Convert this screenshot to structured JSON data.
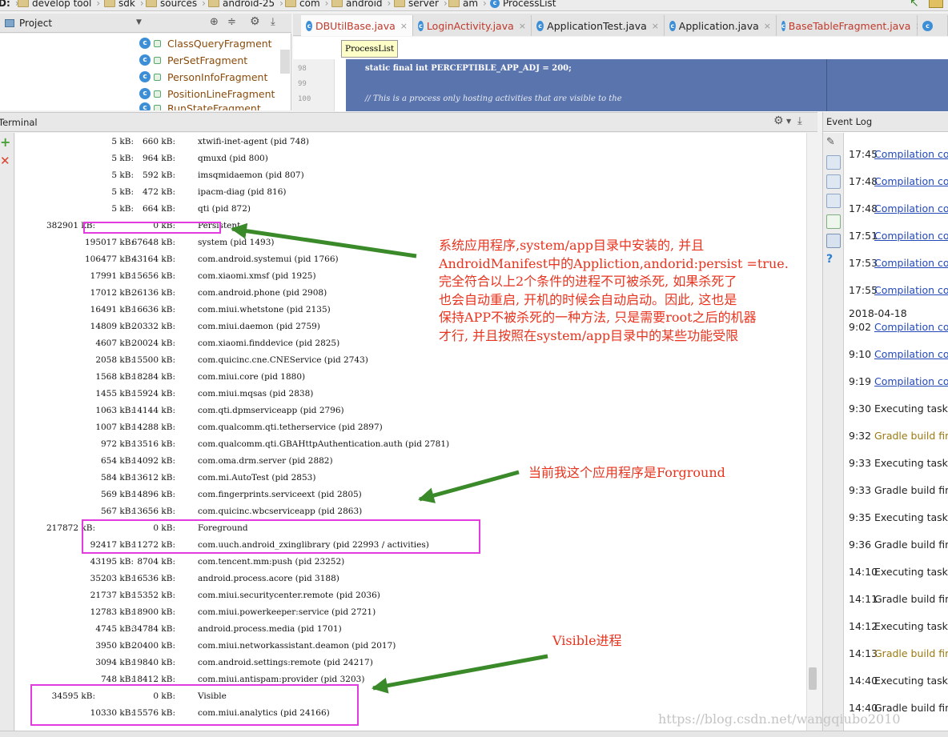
{
  "breadcrumb": {
    "drive": "D:",
    "items": [
      "develop tool",
      "sdk",
      "sources",
      "android-25",
      "com",
      "android",
      "server",
      "am"
    ],
    "current": "ProcessList"
  },
  "project_panel": {
    "title": "Project",
    "tree": [
      "ClassQueryFragment",
      "PerSetFragment",
      "PersonInfoFragment",
      "PositionLineFragment",
      "RunStateFragment"
    ]
  },
  "editor": {
    "tabs": [
      "DBUtilBase.java",
      "LoginActivity.java",
      "ApplicationTest.java",
      "Application.java",
      "BaseTableFragment.java"
    ],
    "tooltip": "ProcessList",
    "lines": [
      {
        "num": "98",
        "code": "static final int PERCEPTIBLE_APP_ADJ = 200;"
      },
      {
        "num": "99",
        "code": ""
      },
      {
        "num": "100",
        "code": "// This is a process only hosting activities that are visible to the"
      }
    ]
  },
  "terminal": {
    "title": "Terminal",
    "rows": [
      {
        "total": "",
        "pss": "5 kB:",
        "mem": "660 kB:",
        "name": "xtwifi-inet-agent (pid 748)"
      },
      {
        "total": "",
        "pss": "5 kB:",
        "mem": "964 kB:",
        "name": "qmuxd (pid 800)"
      },
      {
        "total": "",
        "pss": "5 kB:",
        "mem": "592 kB:",
        "name": "imsqmidaemon (pid 807)"
      },
      {
        "total": "",
        "pss": "5 kB:",
        "mem": "472 kB:",
        "name": "ipacm-diag (pid 816)"
      },
      {
        "total": "",
        "pss": "5 kB:",
        "mem": "664 kB:",
        "name": "qti (pid 872)"
      },
      {
        "total": "382901 kB:",
        "pss": "",
        "mem": "0 kB:",
        "name": "Persistent"
      },
      {
        "total": "",
        "pss": "195017 kB:",
        "mem": "67648 kB:",
        "name": "system (pid 1493)"
      },
      {
        "total": "",
        "pss": "106477 kB:",
        "mem": "43164 kB:",
        "name": "com.android.systemui (pid 1766)"
      },
      {
        "total": "",
        "pss": "17991 kB:",
        "mem": "15656 kB:",
        "name": "com.xiaomi.xmsf (pid 1925)"
      },
      {
        "total": "",
        "pss": "17012 kB:",
        "mem": "26136 kB:",
        "name": "com.android.phone (pid 2908)"
      },
      {
        "total": "",
        "pss": "16491 kB:",
        "mem": "16636 kB:",
        "name": "com.miui.whetstone (pid 2135)"
      },
      {
        "total": "",
        "pss": "14809 kB:",
        "mem": "20332 kB:",
        "name": "com.miui.daemon (pid 2759)"
      },
      {
        "total": "",
        "pss": "4607 kB:",
        "mem": "20024 kB:",
        "name": "com.xiaomi.finddevice (pid 2825)"
      },
      {
        "total": "",
        "pss": "2058 kB:",
        "mem": "15500 kB:",
        "name": "com.quicinc.cne.CNEService (pid 2743)"
      },
      {
        "total": "",
        "pss": "1568 kB:",
        "mem": "18284 kB:",
        "name": "com.miui.core (pid 1880)"
      },
      {
        "total": "",
        "pss": "1455 kB:",
        "mem": "15924 kB:",
        "name": "com.miui.mqsas (pid 2838)"
      },
      {
        "total": "",
        "pss": "1063 kB:",
        "mem": "14144 kB:",
        "name": "com.qti.dpmserviceapp (pid 2796)"
      },
      {
        "total": "",
        "pss": "1007 kB:",
        "mem": "14288 kB:",
        "name": "com.qualcomm.qti.tetherservice (pid 2897)"
      },
      {
        "total": "",
        "pss": "972 kB:",
        "mem": "13516 kB:",
        "name": "com.qualcomm.qti.GBAHttpAuthentication.auth (pid 2781)"
      },
      {
        "total": "",
        "pss": "654 kB:",
        "mem": "14092 kB:",
        "name": "com.oma.drm.server (pid 2882)"
      },
      {
        "total": "",
        "pss": "584 kB:",
        "mem": "13612 kB:",
        "name": "com.mi.AutoTest (pid 2853)"
      },
      {
        "total": "",
        "pss": "569 kB:",
        "mem": "14896 kB:",
        "name": "com.fingerprints.serviceext (pid 2805)"
      },
      {
        "total": "",
        "pss": "567 kB:",
        "mem": "13656 kB:",
        "name": "com.quicinc.wbcserviceapp (pid 2863)"
      },
      {
        "total": "217872 kB:",
        "pss": "",
        "mem": "0 kB:",
        "name": "Foreground"
      },
      {
        "total": "",
        "pss": "92417 kB:",
        "mem": "11272 kB:",
        "name": "com.uuch.android_zxinglibrary (pid 22993 / activities)"
      },
      {
        "total": "",
        "pss": "43195 kB:",
        "mem": "8704 kB:",
        "name": "com.tencent.mm:push (pid 23252)"
      },
      {
        "total": "",
        "pss": "35203 kB:",
        "mem": "16536 kB:",
        "name": "android.process.acore (pid 3188)"
      },
      {
        "total": "",
        "pss": "21737 kB:",
        "mem": "15352 kB:",
        "name": "com.miui.securitycenter.remote (pid 2036)"
      },
      {
        "total": "",
        "pss": "12783 kB:",
        "mem": "18900 kB:",
        "name": "com.miui.powerkeeper:service (pid 2721)"
      },
      {
        "total": "",
        "pss": "4745 kB:",
        "mem": "34784 kB:",
        "name": "android.process.media (pid 1701)"
      },
      {
        "total": "",
        "pss": "3950 kB:",
        "mem": "20400 kB:",
        "name": "com.miui.networkassistant.deamon (pid 2017)"
      },
      {
        "total": "",
        "pss": "3094 kB:",
        "mem": "19840 kB:",
        "name": "com.android.settings:remote (pid 24217)"
      },
      {
        "total": "",
        "pss": "748 kB:",
        "mem": "18412 kB:",
        "name": "com.miui.antispam:provider (pid 3203)"
      },
      {
        "total": "34595 kB:",
        "pss": "",
        "mem": "0 kB:",
        "name": "Visible"
      },
      {
        "total": "",
        "pss": "10330 kB:",
        "mem": "15576 kB:",
        "name": "com.miui.analytics (pid 24166)"
      }
    ]
  },
  "event_log": {
    "title": "Event Log",
    "entries": [
      {
        "time": "17:45",
        "text": "Compilation cor",
        "kind": "link"
      },
      {
        "time": "17:48",
        "text": "Compilation cor",
        "kind": "link"
      },
      {
        "time": "17:48",
        "text": "Compilation cor",
        "kind": "link"
      },
      {
        "time": "17:51",
        "text": "Compilation cor",
        "kind": "link"
      },
      {
        "time": "17:53",
        "text": "Compilation cor",
        "kind": "link"
      },
      {
        "time": "17:55",
        "text": "Compilation cor",
        "kind": "link"
      },
      {
        "time": "9:02",
        "text": "Compilation cor",
        "kind": "link",
        "date": "2018-04-18"
      },
      {
        "time": "9:10",
        "text": "Compilation cor",
        "kind": "link"
      },
      {
        "time": "9:19",
        "text": "Compilation cor",
        "kind": "link"
      },
      {
        "time": "9:30",
        "text": "Executing tasks:",
        "kind": "plain"
      },
      {
        "time": "9:32",
        "text": "Gradle build fini",
        "kind": "gradle"
      },
      {
        "time": "9:33",
        "text": "Executing tasks:",
        "kind": "plain"
      },
      {
        "time": "9:33",
        "text": "Gradle build fini",
        "kind": "plain"
      },
      {
        "time": "9:35",
        "text": "Executing tasks:",
        "kind": "plain"
      },
      {
        "time": "9:36",
        "text": "Gradle build fini",
        "kind": "plain"
      },
      {
        "time": "14:10",
        "text": "Executing tasks:",
        "kind": "plain"
      },
      {
        "time": "14:11",
        "text": "Gradle build fini",
        "kind": "plain"
      },
      {
        "time": "14:12",
        "text": "Executing tasks:",
        "kind": "plain"
      },
      {
        "time": "14:13",
        "text": "Gradle build fini",
        "kind": "gradle"
      },
      {
        "time": "14:40",
        "text": "Executing tasks:",
        "kind": "plain"
      },
      {
        "time": "14:40",
        "text": "Gradle build fini",
        "kind": "plain"
      }
    ]
  },
  "annotations": {
    "persistent_note": [
      "系统应用程序,system/app目录中安装的, 并且",
      "AndroidManifest中的Appliction,andorid:persist =true.",
      "完全符合以上2个条件的进程不可被杀死, 如果杀死了",
      "也会自动重启, 开机的时候会自动启动。因此, 这也是",
      "保持APP不被杀死的一种方法, 只是需要root之后的机器",
      "才行, 并且按照在system/app目录中的某些功能受限"
    ],
    "foreground_note": "当前我这个应用程序是Forground",
    "visible_note": "Visible进程",
    "watermark": "https://blog.csdn.net/wangqiubo2010"
  },
  "colors": {
    "highlight_box": "#e23ce0",
    "annotation_text": "#e8331e",
    "arrow": "#3a8a2a",
    "selection": "#5a74ad",
    "link": "#2349b8"
  }
}
